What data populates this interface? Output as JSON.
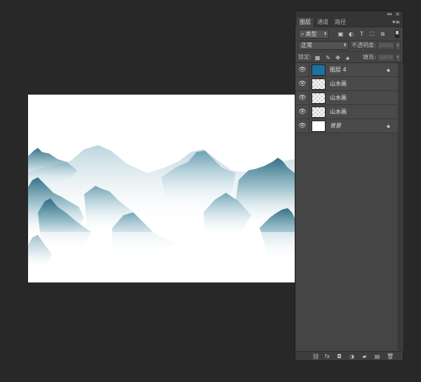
{
  "panel": {
    "tabs": [
      "图层",
      "通道",
      "路径"
    ],
    "filter": {
      "kind_label": "类型"
    },
    "blend_mode": "正常",
    "opacity_label": "不透明度:",
    "opacity_value": "100%",
    "lock_label": "锁定:",
    "fill_label": "填充:",
    "fill_value": "100%"
  },
  "layers": [
    {
      "name": "图层 4",
      "thumbnail": "solid-blue",
      "visible": true,
      "locked": true
    },
    {
      "name": "山水画",
      "thumbnail": "transparent",
      "visible": true,
      "locked": false
    },
    {
      "name": "山水画",
      "thumbnail": "transparent",
      "visible": true,
      "locked": false
    },
    {
      "name": "山水画",
      "thumbnail": "transparent",
      "visible": true,
      "locked": false
    },
    {
      "name": "背景",
      "thumbnail": "white",
      "visible": true,
      "locked": true
    }
  ],
  "colors": {
    "app_background": "#282828",
    "panel_background": "#444444",
    "layer_fill_thumbnail": "#1a73a4",
    "mountain_ink": "#2f6f85"
  }
}
